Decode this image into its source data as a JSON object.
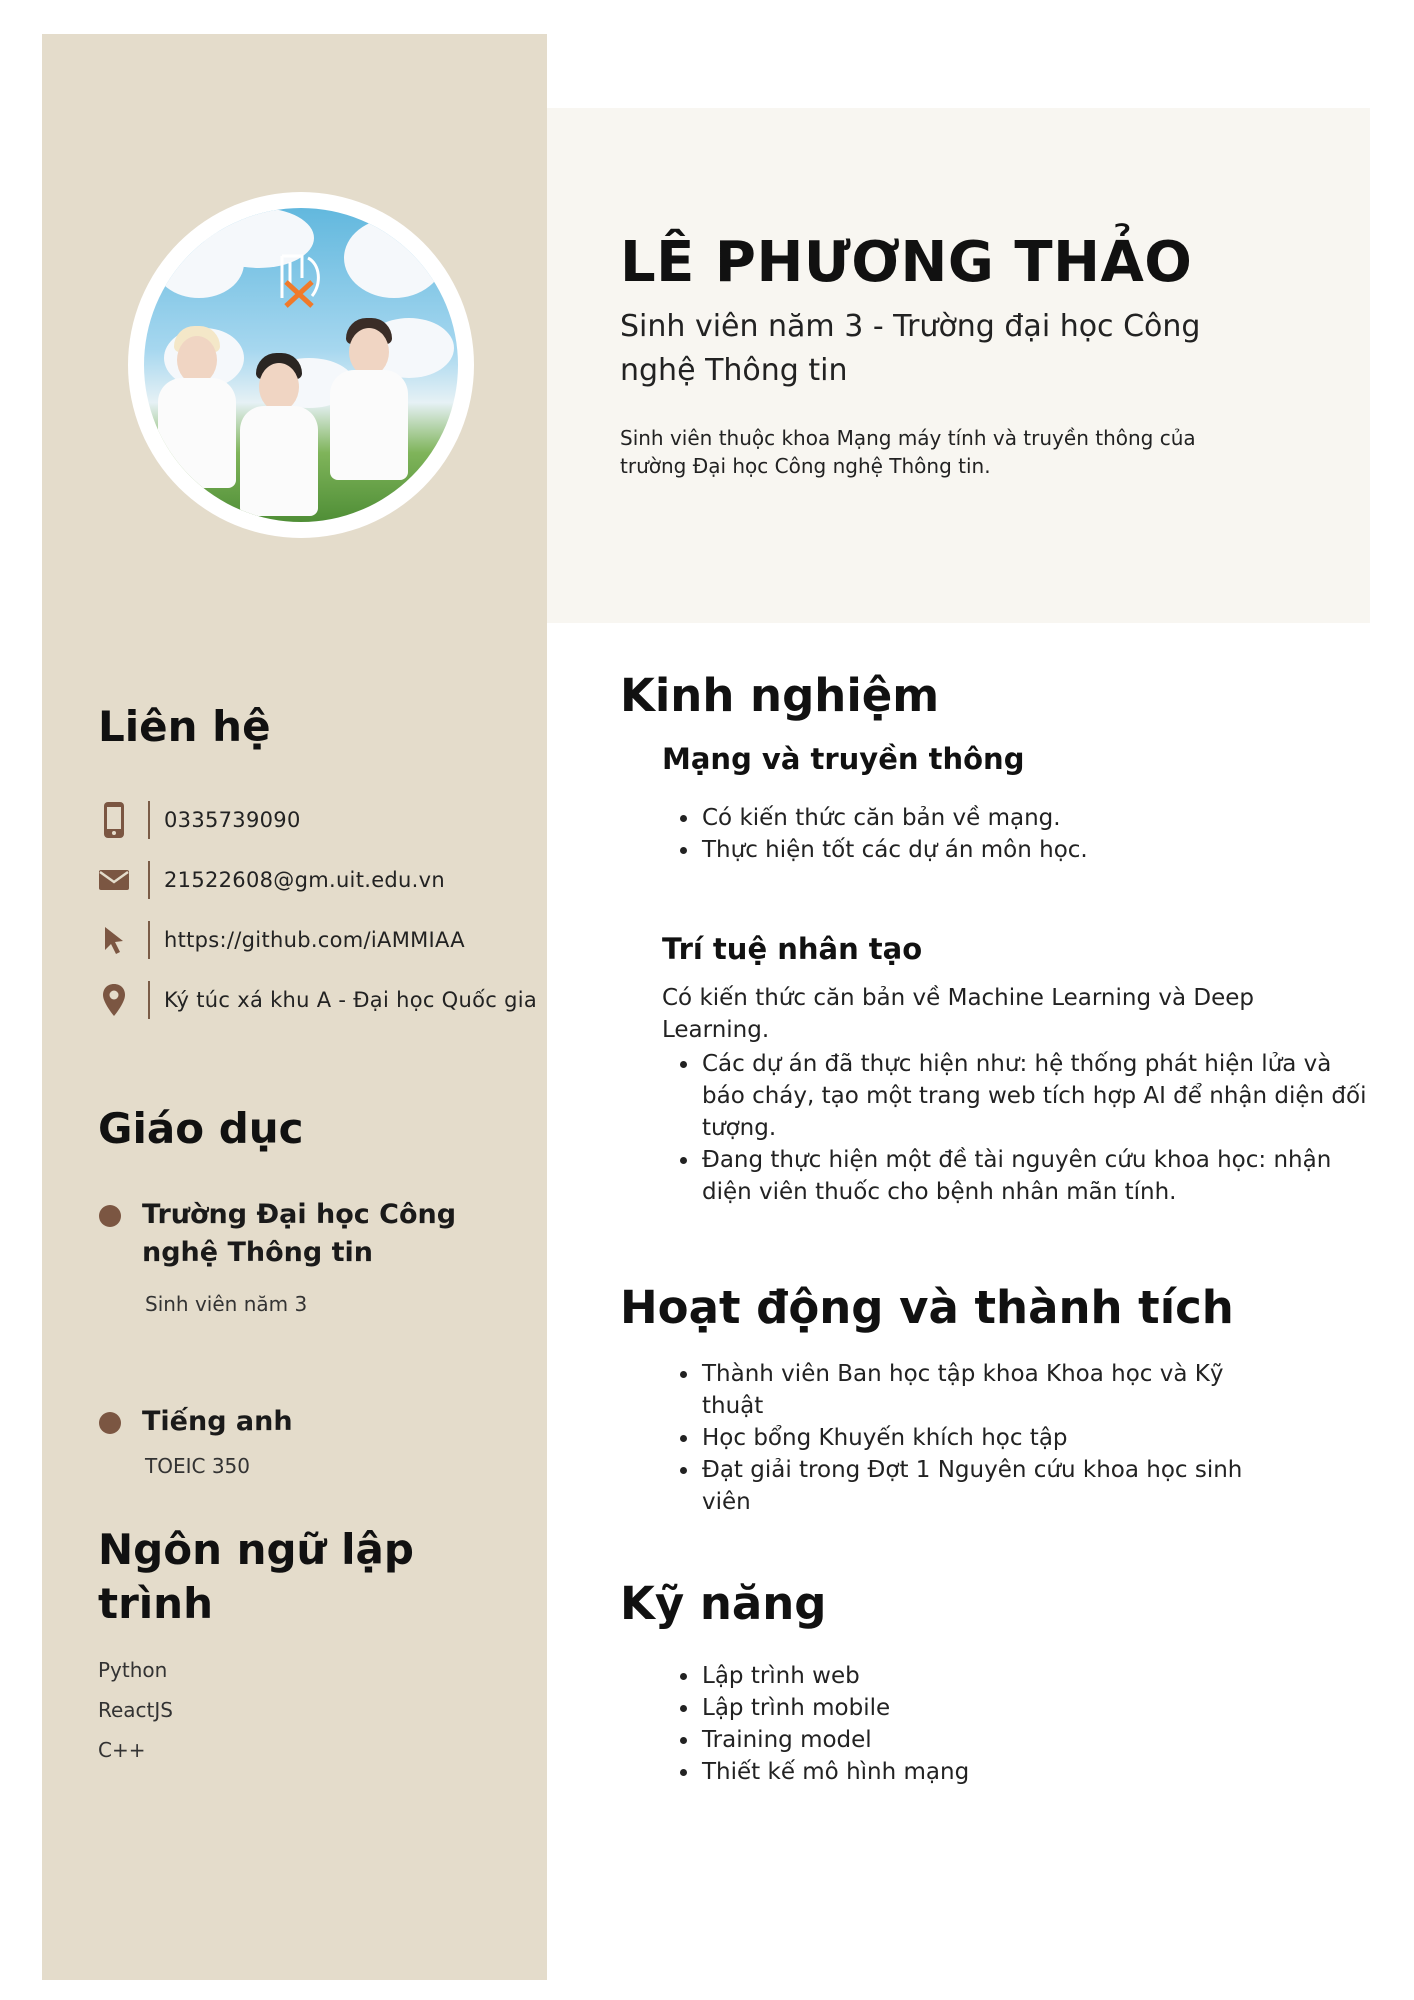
{
  "profile": {
    "name": "LÊ PHƯƠNG THẢO",
    "subtitle": "Sinh viên năm 3 - Trường đại học Công nghệ Thông tin",
    "intro": "Sinh viên thuộc khoa Mạng máy tính và truyền thông của trường Đại học Công nghệ Thông tin."
  },
  "contact": {
    "heading": "Liên hệ",
    "items": [
      {
        "icon": "phone-icon",
        "text": "0335739090"
      },
      {
        "icon": "mail-icon",
        "text": "21522608@gm.uit.edu.vn"
      },
      {
        "icon": "cursor-icon",
        "text": "https://github.com/iAMMIAA"
      },
      {
        "icon": "location-pin-icon",
        "text": "Ký túc xá khu A - Đại học Quốc gia"
      }
    ]
  },
  "education": {
    "heading": "Giáo dục",
    "items": [
      {
        "title": "Trường Đại học Công nghệ Thông tin",
        "detail": "Sinh viên năm 3"
      },
      {
        "title": "Tiếng anh",
        "detail": "TOEIC 350"
      }
    ]
  },
  "languages": {
    "heading": "Ngôn ngữ lập trình",
    "items": [
      "Python",
      "ReactJS",
      "C++"
    ]
  },
  "experience": {
    "heading": "Kinh nghiệm",
    "networking": {
      "title": "Mạng và truyền thông",
      "bullets": [
        "Có kiến thức căn bản về mạng.",
        "Thực hiện tốt các dự án môn học."
      ]
    },
    "ai": {
      "title": "Trí tuệ nhân tạo",
      "intro": "Có kiến thức căn bản về Machine Learning và Deep Learning.",
      "bullets": [
        "Các dự án đã thực hiện như: hệ thống phát hiện lửa và báo cháy, tạo một trang web tích hợp AI để nhận diện đối tượng.",
        "Đang thực hiện một đề tài nguyên cứu khoa học: nhận diện viên thuốc cho bệnh nhân mãn tính."
      ]
    }
  },
  "activities": {
    "heading": "Hoạt động và thành tích",
    "bullets": [
      "Thành viên Ban học tập khoa Khoa học và Kỹ thuật",
      "Học bổng Khuyến khích học tập",
      "Đạt giải trong Đợt 1 Nguyên cứu khoa học sinh viên"
    ]
  },
  "skills": {
    "heading": "Kỹ năng",
    "bullets": [
      "Lập trình web",
      "Lập trình mobile",
      "Training model",
      "Thiết kế mô hình mạng"
    ]
  },
  "colors": {
    "sidebar": "#e4dccb",
    "header_panel": "#f8f6f1",
    "accent_brown": "#7b5642"
  }
}
